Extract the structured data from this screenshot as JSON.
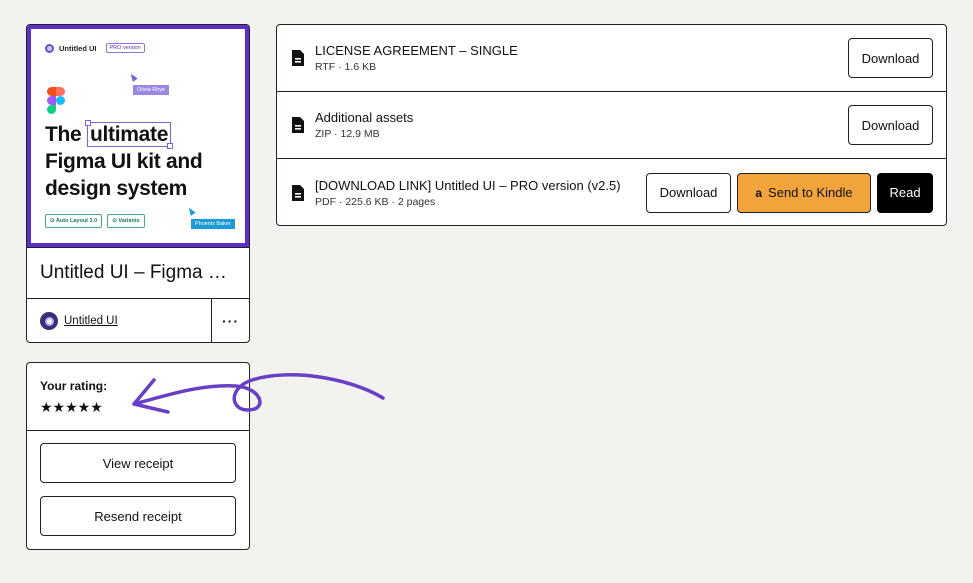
{
  "product": {
    "cover": {
      "brand_name": "Untitled UI",
      "pro_badge": "PRO version",
      "headline_pre": "The",
      "headline_highlight": "ultimate",
      "headline_line2": "Figma UI kit and",
      "headline_line3": "design system",
      "cursor_tag_1": "Olivia Rhye",
      "cursor_tag_2": "Phoenix Baker",
      "chip_1": "Auto Layout 3.0",
      "chip_2": "Variants",
      "bg_color": "#5b2fc9"
    },
    "title": "Untitled UI – Figma …",
    "creator_name": "Untitled UI",
    "more_label": "···"
  },
  "rating": {
    "label": "Your rating:",
    "stars": "★★★★★",
    "view_receipt": "View receipt",
    "resend_receipt": "Resend receipt"
  },
  "files": [
    {
      "name": "LICENSE AGREEMENT – SINGLE",
      "meta": "RTF · 1.6 KB",
      "download": "Download"
    },
    {
      "name": "Additional assets",
      "meta": "ZIP · 12.9 MB",
      "download": "Download"
    },
    {
      "name": "[DOWNLOAD LINK] Untitled UI – PRO version (v2.5)",
      "meta": "PDF · 225.6 KB · 2 pages",
      "download": "Download",
      "kindle": "Send to Kindle",
      "amazon_icon": "a",
      "read": "Read"
    }
  ],
  "colors": {
    "background": "#f2f2ee",
    "kindle_button": "#f1a33c",
    "read_button": "#000000",
    "arrow": "#6a3fc7"
  }
}
